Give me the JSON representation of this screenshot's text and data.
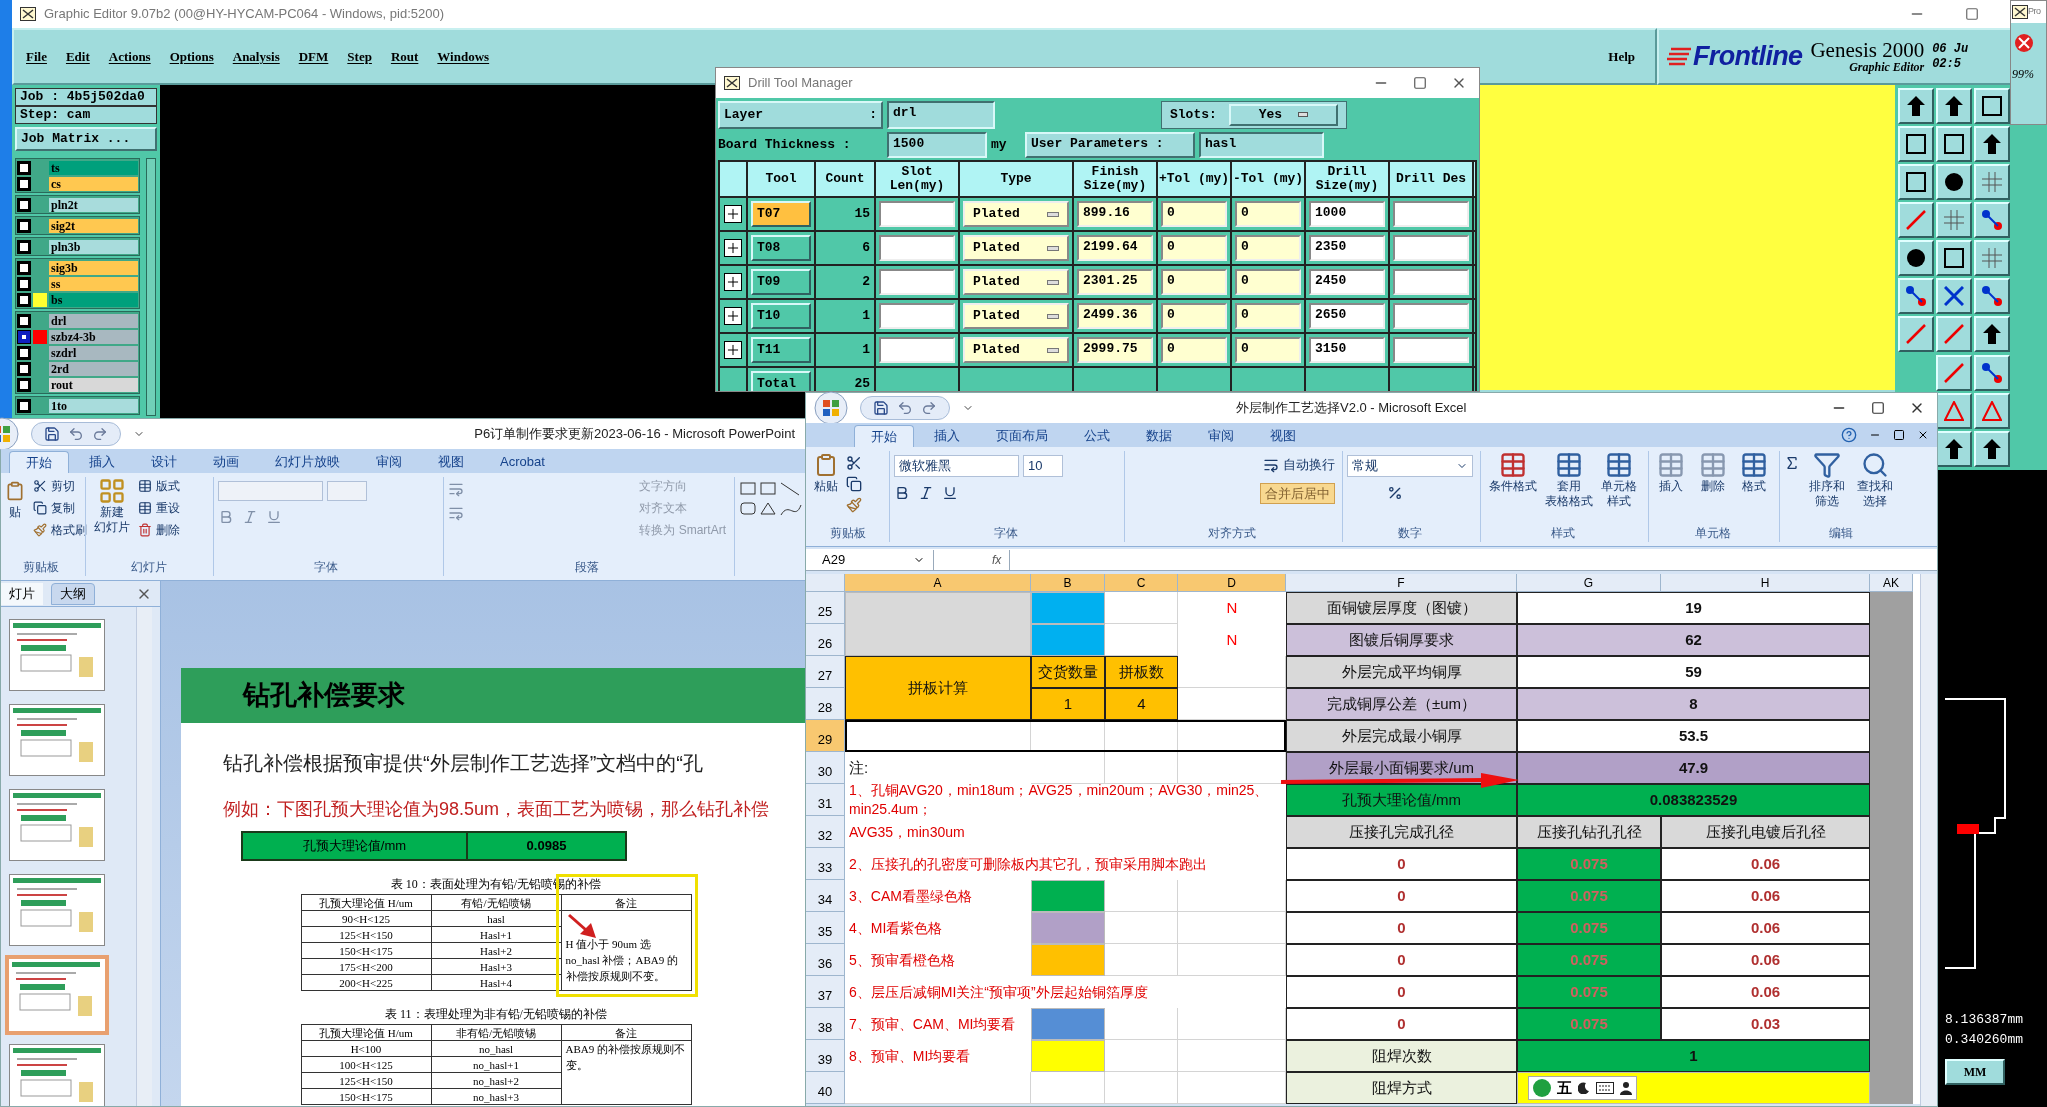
{
  "genesis": {
    "title": "Graphic Editor 9.07b2 (00@HY-HYCAM-PC064 - Windows, pid:5200)",
    "menu": [
      "File",
      "Edit",
      "Actions",
      "Options",
      "Analysis",
      "DFM",
      "Step",
      "Rout",
      "Windows"
    ],
    "help": "Help",
    "logo": "Frontline",
    "product": "Genesis 2000",
    "subtitle": "Graphic Editor",
    "date": "06 Ju",
    "time": "02:5",
    "job": "Job : 4b5j502da0",
    "step": "Step: cam",
    "job_matrix": "Job Matrix ...",
    "layer_groups": [
      [
        {
          "name": "ts",
          "color": "#00a07c",
          "selected": false
        },
        {
          "name": "cs",
          "color": "#ffc850",
          "selected": false
        }
      ],
      [
        {
          "name": "pln2t",
          "color": "#a8dcdc",
          "selected": false
        }
      ],
      [
        {
          "name": "sig2t",
          "color": "#ffc850",
          "selected": false
        }
      ],
      [
        {
          "name": "pln3b",
          "color": "#a8dcdc",
          "selected": false
        }
      ],
      [
        {
          "name": "sig3b",
          "color": "#ffc850",
          "selected": false
        },
        {
          "name": "ss",
          "color": "#ffc850",
          "selected": false
        },
        {
          "name": "bs",
          "color": "#00a07c",
          "marker": {
            "color": "#ffff30"
          },
          "selected": false
        }
      ],
      [
        {
          "name": "drl",
          "color": "#a8b8c0",
          "selected": false
        },
        {
          "name": "szbz4-3b",
          "color": "#a8b8c0",
          "marker": {
            "color": "#ff0000"
          },
          "selected": true
        },
        {
          "name": "szdrl",
          "color": "#a8b8c0",
          "selected": false
        },
        {
          "name": "2rd",
          "color": "#a8b8c0",
          "selected": false
        },
        {
          "name": "rout",
          "color": "#d8d8d8",
          "selected": false
        }
      ],
      [
        {
          "name": "1to",
          "color": "#a8dcdc",
          "selected": false
        }
      ]
    ],
    "coordinates": [
      "8.136387mm",
      "0.340260mm"
    ],
    "units": "MM"
  },
  "progress_window": {
    "title": "Pro",
    "percent": "99%"
  },
  "drill_tool_manager": {
    "title": "Drill Tool Manager",
    "layer_label": "Layer",
    "layer_colon": ":",
    "layer": "drl",
    "slots_label": "Slots:",
    "slots": "Yes",
    "thickness_label": "Board Thickness :",
    "thickness": "1500",
    "thickness_unit": "my",
    "params_label": "User Parameters :",
    "params": "hasl",
    "columns": [
      "Tool",
      "Count",
      "Slot Len(my)",
      "Type",
      "Finish Size(my)",
      "+Tol (my)",
      "-Tol (my)",
      "Drill Size(my)",
      "Drill Des"
    ],
    "rows": [
      {
        "tool": "T07",
        "count": "15",
        "type": "Plated",
        "finish": "899.16",
        "plus_tol": "0",
        "minus_tol": "0",
        "drill": "1000",
        "selected": true
      },
      {
        "tool": "T08",
        "count": "6",
        "type": "Plated",
        "finish": "2199.64",
        "plus_tol": "0",
        "minus_tol": "0",
        "drill": "2350",
        "selected": false
      },
      {
        "tool": "T09",
        "count": "2",
        "type": "Plated",
        "finish": "2301.25",
        "plus_tol": "0",
        "minus_tol": "0",
        "drill": "2450",
        "selected": false
      },
      {
        "tool": "T10",
        "count": "1",
        "type": "Plated",
        "finish": "2499.36",
        "plus_tol": "0",
        "minus_tol": "0",
        "drill": "2650",
        "selected": false
      },
      {
        "tool": "T11",
        "count": "1",
        "type": "Plated",
        "finish": "2999.75",
        "plus_tol": "0",
        "minus_tol": "0",
        "drill": "3150",
        "selected": false
      }
    ],
    "total_label": "Total",
    "total": "25"
  },
  "powerpoint": {
    "title": "P6订单制作要求更新2023-06-16 - Microsoft PowerPoint",
    "tabs": [
      {
        "label": "开始",
        "selected": true
      },
      {
        "label": "插入",
        "selected": false
      },
      {
        "label": "设计",
        "selected": false
      },
      {
        "label": "动画",
        "selected": false
      },
      {
        "label": "幻灯片放映",
        "selected": false
      },
      {
        "label": "审阅",
        "selected": false
      },
      {
        "label": "视图",
        "selected": false
      },
      {
        "label": "Acrobat",
        "selected": false
      }
    ],
    "clipboard": {
      "paste": "贴",
      "cut": "剪切",
      "copy": "复制",
      "format_painter": "格式刷",
      "label": "剪贴板"
    },
    "slides_group": {
      "new_slide": "新建",
      "new_slide_2": "幻灯片",
      "layout": "版式",
      "reset": "重设",
      "delete": "删除",
      "label": "幻灯片"
    },
    "font_label": "字体",
    "paragraph": {
      "text_direction": "文字方向",
      "align_text": "对齐文本",
      "smartart": "转换为 SmartArt",
      "label": "段落"
    },
    "pane_tabs": [
      {
        "label": "灯片",
        "selected": true
      },
      {
        "label": "大纲",
        "selected": false
      }
    ],
    "slides": [
      {
        "selected": false
      },
      {
        "selected": false
      },
      {
        "selected": false
      },
      {
        "selected": false
      },
      {
        "selected": true
      },
      {
        "selected": false
      }
    ],
    "slide": {
      "title": "钻孔补偿要求",
      "body": "钻孔补偿根据预审提供“外层制作工艺选择”文档中的“孔",
      "example": "例如：下图孔预大理论值为98.5um，表面工艺为喷锡，那么钻孔补偿",
      "value_table": [
        "孔预大理论值/mm",
        "0.0985"
      ],
      "table10": {
        "caption": "表 10：表面处理为有铅/无铅喷锡的补偿",
        "header": [
          "孔预大理论值 H/um",
          "有铅/无铅喷锡",
          "备注"
        ],
        "rows": [
          [
            "90<H<125",
            "hasl"
          ],
          [
            "125<H<150",
            "Hasl+1"
          ],
          [
            "150<H<175",
            "Hasl+2"
          ],
          [
            "175<H<200",
            "Hasl+3"
          ],
          [
            "200<H<225",
            "Hasl+4"
          ]
        ],
        "note": "H 值小于 90um 选 no_hasl 补偿；ABA9 的补偿按原规则不变。"
      },
      "table11": {
        "caption": "表 11：表理处理为非有铅/无铅喷锡的补偿",
        "header": [
          "孔预大理论值 H/um",
          "非有铅/无铅喷锡",
          "备注"
        ],
        "rows": [
          [
            "H<100",
            "no_hasl"
          ],
          [
            "100<H<125",
            "no_hasl+1"
          ],
          [
            "125<H<150",
            "no_hasl+2"
          ],
          [
            "150<H<175",
            "no_hasl+3"
          ]
        ],
        "note": "ABA9 的补偿按原规则不变。"
      }
    }
  },
  "excel": {
    "title": "外层制作工艺选择V2.0 - Microsoft Excel",
    "tabs": [
      {
        "label": "开始",
        "selected": true
      },
      {
        "label": "插入",
        "selected": false
      },
      {
        "label": "页面布局",
        "selected": false
      },
      {
        "label": "公式",
        "selected": false
      },
      {
        "label": "数据",
        "selected": false
      },
      {
        "label": "审阅",
        "selected": false
      },
      {
        "label": "视图",
        "selected": false
      }
    ],
    "ribbon": {
      "paste": "粘贴",
      "clipboard": "剪贴板",
      "font": "微软雅黑",
      "size": "10",
      "font_label": "字体",
      "wrap": "自动换行",
      "merge": "合并后居中",
      "align_label": "对齐方式",
      "number_format": "常规",
      "number_label": "数字",
      "conditional": "条件格式",
      "table_format": "套用",
      "table_format_2": "表格格式",
      "cell_style": "单元格",
      "cell_style_2": "样式",
      "styles_label": "样式",
      "insert": "插入",
      "delete": "删除",
      "format": "格式",
      "cells_label": "单元格",
      "sort": "排序和",
      "sort_2": "筛选",
      "find": "查找和",
      "find_2": "选择",
      "edit_label": "编辑"
    },
    "name_box": "A29",
    "fx": "fx",
    "columns": [
      {
        "label": "A",
        "selected": true
      },
      {
        "label": "B",
        "selected": true
      },
      {
        "label": "C",
        "selected": true
      },
      {
        "label": "D",
        "selected": true
      },
      {
        "label": "F",
        "selected": false
      },
      {
        "label": "G",
        "selected": false
      },
      {
        "label": "H",
        "selected": false
      },
      {
        "label": "AK",
        "selected": false
      }
    ],
    "row_numbers": [
      {
        "label": "25",
        "selected": false
      },
      {
        "label": "26",
        "selected": false
      },
      {
        "label": "27",
        "selected": false
      },
      {
        "label": "28",
        "selected": false
      },
      {
        "label": "29",
        "selected": true
      },
      {
        "label": "30",
        "selected": false
      },
      {
        "label": "31",
        "selected": false
      },
      {
        "label": "32",
        "selected": false
      },
      {
        "label": "33",
        "selected": false
      },
      {
        "label": "34",
        "selected": false
      },
      {
        "label": "35",
        "selected": false
      },
      {
        "label": "36",
        "selected": false
      },
      {
        "label": "37",
        "selected": false
      },
      {
        "label": "38",
        "selected": false
      },
      {
        "label": "39",
        "selected": false
      },
      {
        "label": "40",
        "selected": false
      }
    ],
    "cells": [
      {
        "color": "#d9d9d9"
      },
      {
        "color": "#00b0f0"
      },
      {
        "text": "N",
        "kind": "flag"
      },
      {
        "text": "面铜镀层厚度（图镀）",
        "kind": "label",
        "color": "#d9d9d9"
      },
      {
        "text": "19",
        "kind": "value"
      },
      {
        "color": "#00b0f0"
      },
      {
        "text": "N",
        "kind": "flag"
      },
      {
        "text": "图镀后铜厚要求",
        "kind": "label",
        "color": "#ccc0da"
      },
      {
        "text": "62",
        "kind": "value",
        "color": "#ccc0da"
      },
      {
        "text": "拼板计算",
        "kind": "label",
        "color": "#ffc000"
      },
      {
        "text": "交货数量",
        "kind": "label",
        "color": "#ffc000"
      },
      {
        "text": "拼板数",
        "kind": "label",
        "color": "#ffc000"
      },
      {
        "text": "外层完成平均铜厚",
        "kind": "label",
        "color": "#d9d9d9"
      },
      {
        "text": "59",
        "kind": "value"
      },
      {
        "text": "1",
        "kind": "label",
        "color": "#ffc000"
      },
      {
        "text": "4",
        "kind": "label",
        "color": "#ffc000"
      },
      {
        "text": "完成铜厚公差（±um）",
        "kind": "label",
        "color": "#ccc0da"
      },
      {
        "text": "8",
        "kind": "value",
        "color": "#ccc0da"
      },
      {
        "text": "外层完成最小铜厚",
        "kind": "label",
        "color": "#d9d9d9"
      },
      {
        "text": "53.5",
        "kind": "value"
      },
      {
        "text": "注:",
        "kind": "plain"
      },
      {
        "text": "外层最小面铜要求/um",
        "kind": "label",
        "color": "#b1a0c7"
      },
      {
        "text": "47.9",
        "kind": "value",
        "color": "#b1a0c7"
      },
      {
        "text": "1、孔铜AVG20，min18um；AVG25，min20um；AVG30，min25、min25.4um；",
        "kind": "note"
      },
      {
        "text": "孔预大理论值/mm",
        "kind": "label",
        "color": "#00b050"
      },
      {
        "text": "0.083823529",
        "kind": "value",
        "color": "#00b050"
      },
      {
        "text": "AVG35，min30um",
        "kind": "note"
      },
      {
        "text": "压接孔完成孔径",
        "kind": "label",
        "color": "#d9d9d9"
      },
      {
        "text": "压接孔钻孔孔径",
        "kind": "label",
        "color": "#d9d9d9"
      },
      {
        "text": "压接孔电镀后孔径",
        "kind": "label",
        "color": "#d9d9d9"
      },
      {
        "text": "2、压接孔的孔密度可删除板内其它孔，预审采用脚本跑出",
        "kind": "note"
      },
      {
        "text": "0",
        "kind": "alert"
      },
      {
        "text": "0.075",
        "kind": "faint",
        "color": "#00b050"
      },
      {
        "text": "0.06",
        "kind": "alert"
      },
      {
        "text": "3、CAM看墨绿色格",
        "kind": "note"
      },
      {
        "color": "#00b050"
      },
      {
        "text": "0",
        "kind": "alert"
      },
      {
        "text": "0.075",
        "kind": "faint",
        "color": "#00b050"
      },
      {
        "text": "0.06",
        "kind": "alert"
      },
      {
        "text": "4、MI看紫色格",
        "kind": "note"
      },
      {
        "color": "#b1a0c7"
      },
      {
        "text": "0",
        "kind": "alert"
      },
      {
        "text": "0.075",
        "kind": "faint",
        "color": "#00b050"
      },
      {
        "text": "0.06",
        "kind": "alert"
      },
      {
        "text": "5、预审看橙色格",
        "kind": "note"
      },
      {
        "color": "#ffc000"
      },
      {
        "text": "0",
        "kind": "alert"
      },
      {
        "text": "0.075",
        "kind": "faint",
        "color": "#00b050"
      },
      {
        "text": "0.06",
        "kind": "alert"
      },
      {
        "text": "6、层压后减铜MI关注“预审项”外层起始铜箔厚度",
        "kind": "note"
      },
      {
        "text": "0",
        "kind": "alert"
      },
      {
        "text": "0.075",
        "kind": "faint",
        "color": "#00b050"
      },
      {
        "text": "0.06",
        "kind": "alert"
      },
      {
        "text": "7、预审、CAM、MI均要看",
        "kind": "note"
      },
      {
        "color": "#558ed5"
      },
      {
        "text": "0",
        "kind": "alert"
      },
      {
        "text": "0.075",
        "kind": "faint",
        "color": "#00b050"
      },
      {
        "text": "0.03",
        "kind": "alert"
      },
      {
        "text": "8、预审、MI均要看",
        "kind": "note"
      },
      {
        "color": "#ffff00"
      },
      {
        "text": "阻焊次数",
        "kind": "label",
        "color": "#ebf1de"
      },
      {
        "text": "1",
        "kind": "value",
        "color": "#00b050"
      },
      {
        "text": "阻焊方式",
        "kind": "label",
        "color": "#ebf1de"
      },
      {
        "color": "#ffff00"
      }
    ],
    "ime_toolbar": {
      "mode": "五"
    }
  }
}
